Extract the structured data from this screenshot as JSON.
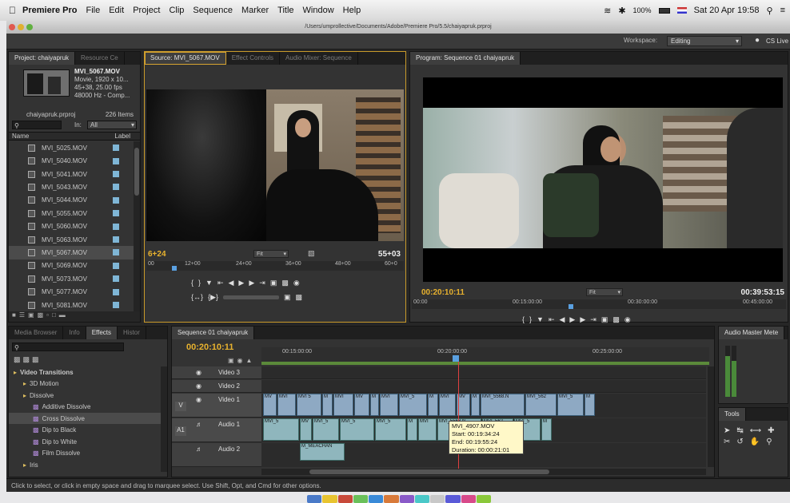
{
  "menubar": {
    "app": "Premiere Pro",
    "items": [
      "File",
      "Edit",
      "Project",
      "Clip",
      "Sequence",
      "Marker",
      "Title",
      "Window",
      "Help"
    ],
    "battery": "100%",
    "clock": "Sat 20 Apr  19:58"
  },
  "titlebar": {
    "path": "/Users/umprollective/Documents/Adobe/Premiere Pro/5.5/chaiyapruk.prproj"
  },
  "workspace": {
    "label": "Workspace:",
    "value": "Editing",
    "cslive": "CS Live"
  },
  "project": {
    "tabs": [
      "Project: chaiyapruk",
      "Resource Ce"
    ],
    "clip_name": "MVI_5067.MOV",
    "clip_info": [
      "Movie, 1920 x 10...",
      "45+38, 25.00 fps",
      "48000 Hz - Comp..."
    ],
    "file": "chaiyapruk.prproj",
    "items_count": "226 Items",
    "in_label": "In:",
    "in_value": "All",
    "col_name": "Name",
    "col_label": "Label",
    "files": [
      "MVI_5025.MOV",
      "MVI_5040.MOV",
      "MVI_5041.MOV",
      "MVI_5043.MOV",
      "MVI_5044.MOV",
      "MVI_5055.MOV",
      "MVI_5060.MOV",
      "MVI_5063.MOV",
      "MVI_5067.MOV",
      "MVI_5069.MOV",
      "MVI_5073.MOV",
      "MVI_5077.MOV",
      "MVI_5081.MOV"
    ]
  },
  "source": {
    "tabs": [
      "Source: MVI_5067.MOV",
      "Effect Controls",
      "Audio Mixer: Sequence"
    ],
    "tc_in": "6+24",
    "tc_out": "55+03",
    "fit": "Fit",
    "ruler": [
      "00",
      "12+00",
      "24+00",
      "36+00",
      "48+00",
      "60+0"
    ]
  },
  "program": {
    "tab": "Program: Sequence 01 chaiyapruk",
    "tc_in": "00:20:10:11",
    "tc_out": "00:39:53:15",
    "fit": "Fit",
    "ruler": [
      "00:00",
      "00:15:00:00",
      "00:30:00:00",
      "00:45:00:00"
    ]
  },
  "effects": {
    "tabs": [
      "Media Browser",
      "Info",
      "Effects",
      "Histor"
    ],
    "tree": [
      {
        "label": "Video Transitions",
        "level": 0
      },
      {
        "label": "3D Motion",
        "level": 1
      },
      {
        "label": "Dissolve",
        "level": 1
      },
      {
        "label": "Additive Dissolve",
        "level": 2
      },
      {
        "label": "Cross Dissolve",
        "level": 2
      },
      {
        "label": "Dip to Black",
        "level": 2
      },
      {
        "label": "Dip to White",
        "level": 2
      },
      {
        "label": "Film Dissolve",
        "level": 2
      },
      {
        "label": "Iris",
        "level": 1
      }
    ]
  },
  "timeline": {
    "tab": "Sequence 01 chaiyapruk",
    "tc": "00:20:10:11",
    "ruler": [
      "00:15:00:00",
      "00:20:00:00",
      "00:25:00:00"
    ],
    "tracks": [
      "Video 3",
      "Video 2",
      "Video 1",
      "Audio 1",
      "Audio 2"
    ],
    "track_tags": [
      "V",
      "A1"
    ],
    "v1_clips": [
      "MV",
      "MVI",
      "MVI 5",
      "M",
      "MVI",
      "MV",
      "M",
      "MVI",
      "MVI_5",
      "M",
      "MVI",
      "MV",
      "M",
      "MVI_5568.N",
      "MVI_562",
      "MVI_5",
      "M"
    ],
    "a1_clips": [
      "MVI_5",
      "MV",
      "MVI_5",
      "MVI_5",
      "MVI_5",
      "M",
      "MVI",
      "MVI_5568.N",
      "MVI_562",
      "MVI_5",
      "M"
    ],
    "a2_clip": "M_MEACHAN",
    "tooltip": [
      "MVI_4907.MOV",
      "Start: 00:19:34:24",
      "End: 00:19:55:24",
      "Duration: 00:00:21:01"
    ]
  },
  "audio_master": {
    "title": "Audio Master Mete"
  },
  "tools": {
    "title": "Tools"
  },
  "status": "Click to select, or click in empty space and drag to marquee select. Use Shift, Opt, and Cmd for other options.",
  "colors": {
    "timecode": "#e8b22e",
    "panel": "#333333",
    "video_clip": "#8ea9c3",
    "audio_clip": "#8fb6bd",
    "label": "#7fb6d6",
    "dock": [
      "#4a7ac8",
      "#e8c430",
      "#c84a3a",
      "#6ac05a",
      "#3a8ad8",
      "#d87a3a",
      "#8a5ac8",
      "#4ac8c8",
      "#c8c8c8",
      "#5a5ad8",
      "#d84a8a",
      "#8ac83a"
    ]
  }
}
